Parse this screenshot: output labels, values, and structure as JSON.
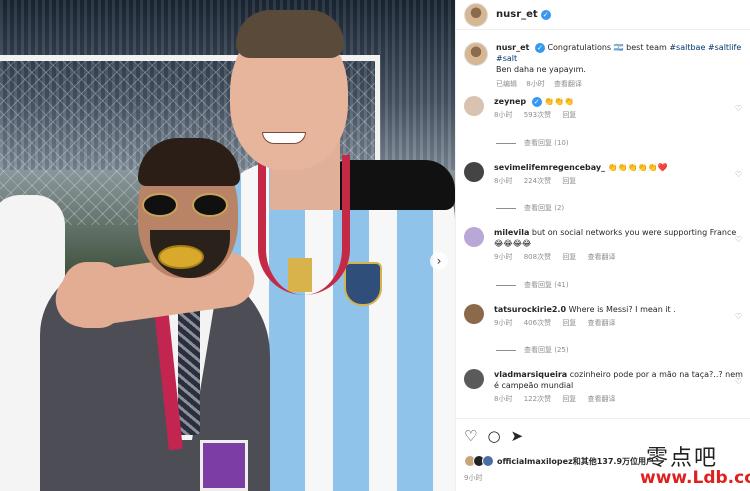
{
  "post": {
    "author": "nusr_et",
    "verified_mark": "✓"
  },
  "caption": {
    "user": "nusr_et",
    "text": "Congratulations",
    "emoji": "🇦🇷",
    "text2": "best team",
    "tags": [
      "#saltbae",
      "#saltlife",
      "#salt"
    ],
    "line2": "Ben daha ne yapayım.",
    "edited": "已编辑",
    "time": "8小时",
    "translate": "查看翻译"
  },
  "comments": [
    {
      "user": "zeynep",
      "verified": true,
      "text": "👏👏👏",
      "time": "8小时",
      "likes": "593次赞",
      "reply": "回复",
      "replies": "查看回复 (10)",
      "avatar_color": "#d9c2b0"
    },
    {
      "user": "sevimelifemregencebay_",
      "verified": false,
      "text": "👏👏👏👏👏❤️",
      "time": "8小时",
      "likes": "224次赞",
      "reply": "回复",
      "replies": "查看回复 (2)",
      "avatar_color": "#444444"
    },
    {
      "user": "milevila",
      "verified": false,
      "text": "but on social networks you were supporting France",
      "text2": "😂😂😂😂",
      "time": "9小时",
      "likes": "808次赞",
      "reply": "回复",
      "translate": "查看翻译",
      "replies": "查看回复 (41)",
      "avatar_color": "#b9a7d8"
    },
    {
      "user": "tatsurockirie2.0",
      "verified": false,
      "text": "Where is Messi? I mean it .",
      "time": "9小时",
      "likes": "406次赞",
      "reply": "回复",
      "translate": "查看翻译",
      "replies": "查看回复 (25)",
      "avatar_color": "#8a6a4a"
    },
    {
      "user": "vladmarsiqueira",
      "verified": false,
      "text": "cozinheiro pode por a mão na taça?..? nem é campeão mundial",
      "time": "8小时",
      "likes": "122次赞",
      "reply": "回复",
      "translate": "查看翻译",
      "avatar_color": "#5a5a5a"
    }
  ],
  "actions": {
    "like_icon": "♡",
    "comment_icon": "○",
    "share_icon": "➤",
    "liked_by": "officialmaxilopez和其他137.9万位用户",
    "post_time": "9小时"
  },
  "carousel": {
    "next_icon": "›"
  },
  "watermark": {
    "top": "零点吧",
    "bottom": "www.Ldb.cc"
  },
  "colors": {
    "link": "#00376b",
    "verified": "#3897f0",
    "muted": "#8e8e8e"
  }
}
